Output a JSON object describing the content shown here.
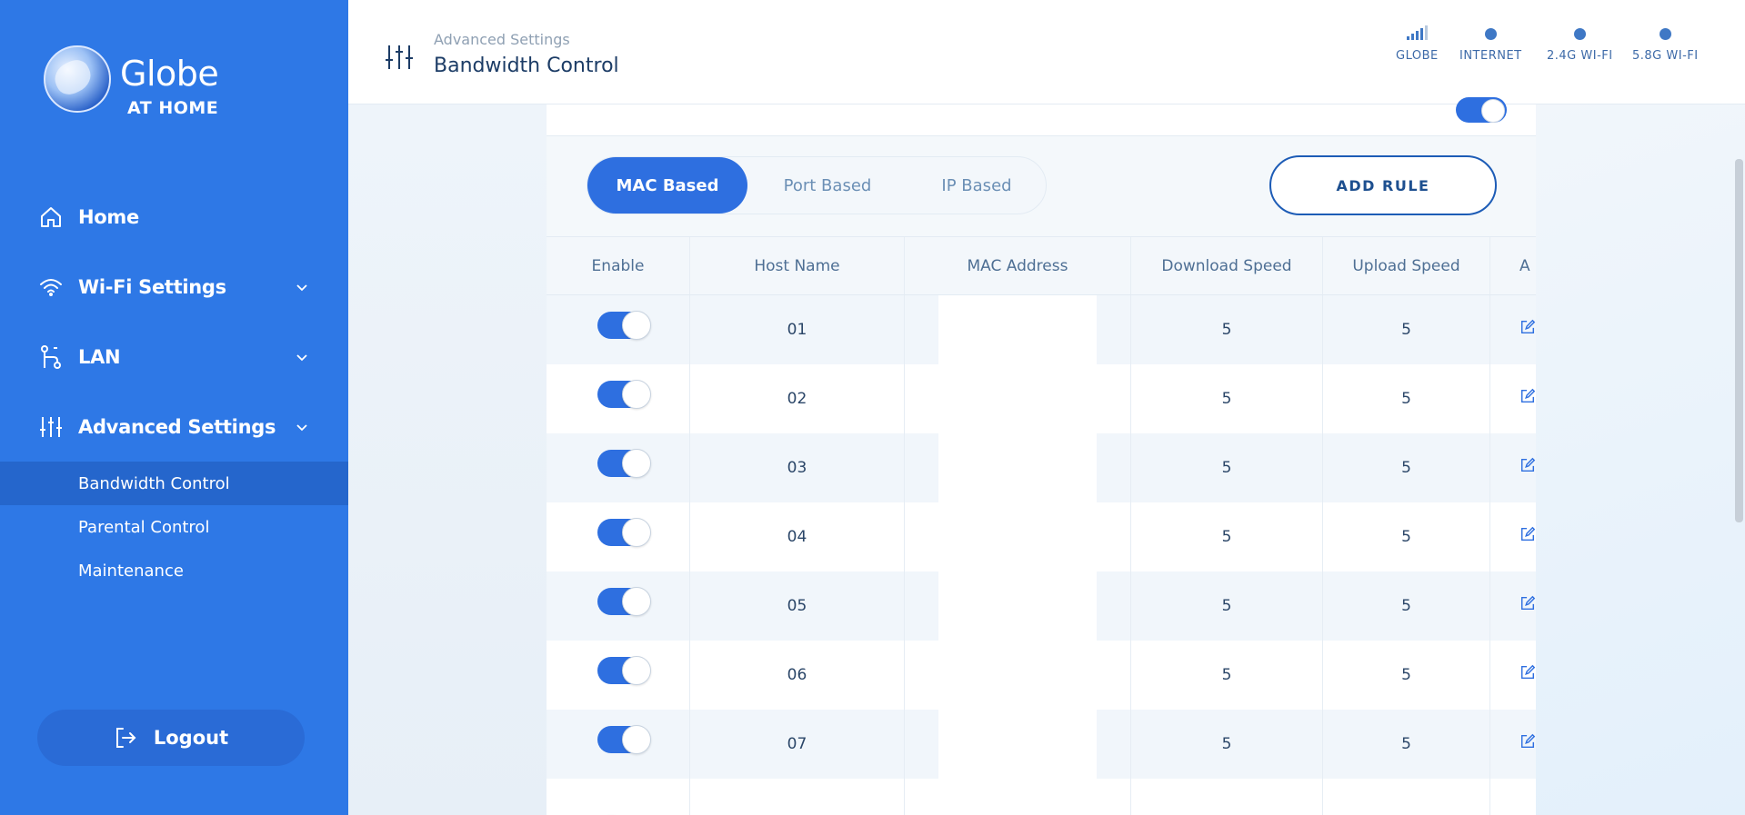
{
  "brand": {
    "name": "Globe",
    "sub": "AT HOME"
  },
  "sidebar": {
    "items": [
      {
        "label": "Home",
        "icon": "home-icon",
        "expandable": false
      },
      {
        "label": "Wi-Fi Settings",
        "icon": "wifi-icon",
        "expandable": true
      },
      {
        "label": "LAN",
        "icon": "lan-icon",
        "expandable": true
      },
      {
        "label": "Advanced Settings",
        "icon": "sliders-icon",
        "expandable": true
      }
    ],
    "subitems": [
      {
        "label": "Bandwidth Control",
        "active": true
      },
      {
        "label": "Parental Control",
        "active": false
      },
      {
        "label": "Maintenance",
        "active": false
      }
    ],
    "logout": "Logout"
  },
  "header": {
    "breadcrumb": "Advanced Settings",
    "title": "Bandwidth Control",
    "status": [
      {
        "label": "GLOBE",
        "icon": "signal-icon"
      },
      {
        "label": "INTERNET",
        "icon": "status-dot-icon"
      },
      {
        "label": "2.4G WI-FI",
        "icon": "status-dot-icon"
      },
      {
        "label": "5.8G WI-FI",
        "icon": "status-dot-icon"
      }
    ]
  },
  "tabs": {
    "items": [
      "MAC Based",
      "Port Based",
      "IP Based"
    ],
    "active": "MAC Based"
  },
  "add_rule": "ADD RULE",
  "table": {
    "columns": [
      "Enable",
      "Host Name",
      "MAC Address",
      "Download Speed",
      "Upload Speed",
      "A"
    ],
    "rows": [
      {
        "enabled": true,
        "host": "01",
        "mac": "",
        "download": "5",
        "upload": "5"
      },
      {
        "enabled": true,
        "host": "02",
        "mac": "",
        "download": "5",
        "upload": "5"
      },
      {
        "enabled": true,
        "host": "03",
        "mac": "",
        "download": "5",
        "upload": "5"
      },
      {
        "enabled": true,
        "host": "04",
        "mac": "",
        "download": "5",
        "upload": "5"
      },
      {
        "enabled": true,
        "host": "05",
        "mac": "",
        "download": "5",
        "upload": "5"
      },
      {
        "enabled": true,
        "host": "06",
        "mac": "",
        "download": "5",
        "upload": "5"
      },
      {
        "enabled": true,
        "host": "07",
        "mac": "",
        "download": "5",
        "upload": "5"
      },
      {
        "enabled": false,
        "host": "",
        "mac": "",
        "download": "",
        "upload": ""
      }
    ]
  },
  "colors": {
    "sidebar": "#2e78e6",
    "accent": "#2e6fe0",
    "active_sub": "#2566cc"
  }
}
